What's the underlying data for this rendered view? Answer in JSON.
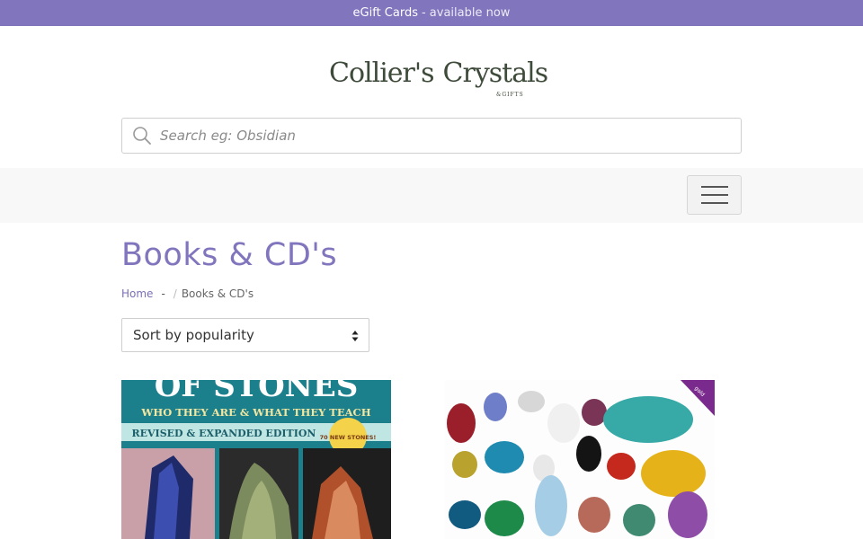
{
  "announcement": {
    "main": "eGift Cards",
    "sub": "- available now"
  },
  "logo": {
    "left_text": "Collier's",
    "right_text": "Crystals",
    "tagline": "&GIFTS"
  },
  "search": {
    "placeholder": "Search eg: Obsidian"
  },
  "page": {
    "title": "Books & CD's"
  },
  "breadcrumb": {
    "home": "Home",
    "separator": "-",
    "slash": "/",
    "current": "Books & CD's"
  },
  "sort": {
    "selected": "Sort by popularity"
  },
  "products": [
    {
      "cover_title": "OF STONES",
      "cover_subtitle": "WHO THEY ARE & WHAT THEY TEACH",
      "cover_edition": "REVISED & EXPANDED EDITION",
      "cover_badge": "70 NEW STONES!"
    },
    {
      "cover_corner": "gold"
    }
  ],
  "colors": {
    "brand": "#8175bd",
    "book_teal": "#1c7f8c"
  },
  "icons": {
    "search": "search-icon",
    "menu": "hamburger-icon",
    "sort": "sort-caret-icon"
  }
}
